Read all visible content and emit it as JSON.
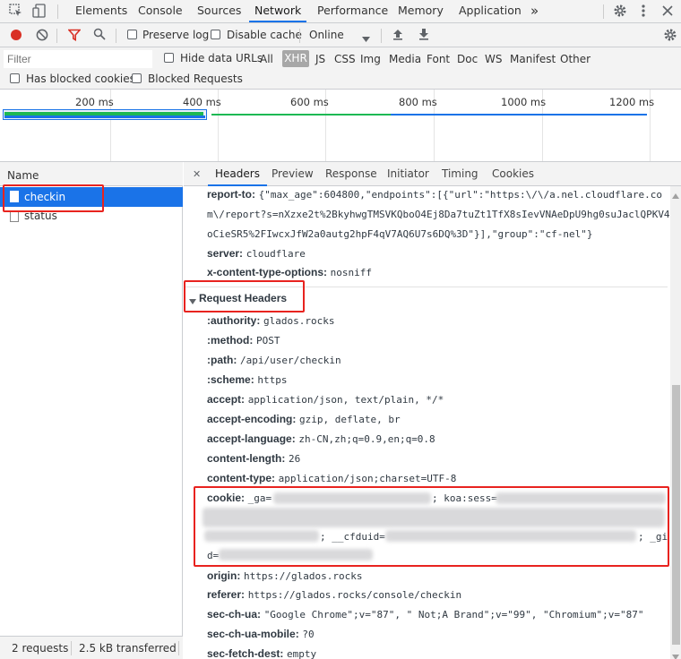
{
  "top_tabs": [
    "Elements",
    "Console",
    "Sources",
    "Network",
    "Performance",
    "Memory",
    "Application"
  ],
  "more_tabs_glyph": "»",
  "toolbar": {
    "preserve_log": "Preserve log",
    "disable_cache": "Disable cache",
    "throttle": "Online"
  },
  "filter": {
    "placeholder": "Filter",
    "hide_data_urls": "Hide data URLs",
    "types": [
      "All",
      "XHR",
      "JS",
      "CSS",
      "Img",
      "Media",
      "Font",
      "Doc",
      "WS",
      "Manifest",
      "Other"
    ],
    "has_blocked_cookies": "Has blocked cookies",
    "blocked_requests": "Blocked Requests"
  },
  "timeline": {
    "ticks": [
      "200 ms",
      "400 ms",
      "600 ms",
      "800 ms",
      "1000 ms",
      "1200 ms"
    ]
  },
  "requests": {
    "header": "Name",
    "items": [
      {
        "name": "checkin",
        "selected": true
      },
      {
        "name": "status",
        "selected": false
      }
    ],
    "footer": {
      "count": "2 requests",
      "transferred": "2.5 kB transferred"
    }
  },
  "detail": {
    "close_glyph": "✕",
    "tabs": [
      "Headers",
      "Preview",
      "Response",
      "Initiator",
      "Timing",
      "Cookies"
    ],
    "response_headers": [
      {
        "key": "report-to:",
        "value": "{\"max_age\":604800,\"endpoints\":[{\"url\":\"https:\\/\\/a.nel.cloudflare.co"
      },
      {
        "key": "",
        "value": "m\\/report?s=nXzxe2t%2BkyhwgTMSVKQboO4Ej8Da7tuZt1TfX8sIevVNAeDpU9hg0suJaclQPKV4"
      },
      {
        "key": "",
        "value": "oCieSR5%2FIwcxJfW2a0autg2hpF4qV7AQ6U7s6DQ%3D\"}],\"group\":\"cf-nel\"}"
      },
      {
        "key": "server:",
        "value": "cloudflare"
      },
      {
        "key": "x-content-type-options:",
        "value": "nosniff"
      }
    ],
    "request_headers_title": "Request Headers",
    "request_headers": [
      {
        "key": ":authority:",
        "value": "glados.rocks"
      },
      {
        "key": ":method:",
        "value": "POST"
      },
      {
        "key": ":path:",
        "value": "/api/user/checkin"
      },
      {
        "key": ":scheme:",
        "value": "https"
      },
      {
        "key": "accept:",
        "value": "application/json, text/plain, */*"
      },
      {
        "key": "accept-encoding:",
        "value": "gzip, deflate, br"
      },
      {
        "key": "accept-language:",
        "value": "zh-CN,zh;q=0.9,en;q=0.8"
      },
      {
        "key": "content-length:",
        "value": "26"
      },
      {
        "key": "content-type:",
        "value": "application/json;charset=UTF-8"
      }
    ],
    "cookie": {
      "key": "cookie:",
      "frag1": "_ga=",
      "frag2": "; koa:sess=",
      "frag3": "; __cfduid=",
      "frag4": "; _gi",
      "frag5": "d="
    },
    "request_headers_after": [
      {
        "key": "origin:",
        "value": "https://glados.rocks"
      },
      {
        "key": "referer:",
        "value": "https://glados.rocks/console/checkin"
      },
      {
        "key": "sec-ch-ua:",
        "value": "\"Google Chrome\";v=\"87\", \" Not;A Brand\";v=\"99\", \"Chromium\";v=\"87\""
      },
      {
        "key": "sec-ch-ua-mobile:",
        "value": "?0"
      },
      {
        "key": "sec-fetch-dest:",
        "value": "empty"
      }
    ]
  },
  "colors": {
    "accent": "#1a73e8",
    "record_red": "#d93025",
    "highlight_red": "#e8231f",
    "timeline_green": "#1db954",
    "timeline_blue": "#1a73e8"
  }
}
